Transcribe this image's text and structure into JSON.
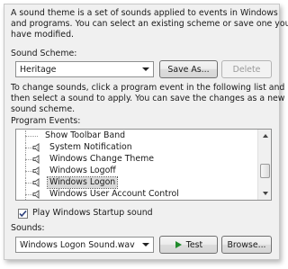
{
  "intro_text": [
    "A sound theme is a set of sounds applied to events in Windows",
    "and programs.  You can select an existing scheme or save one you",
    "have modified."
  ],
  "scheme": {
    "label": "Sound Scheme:",
    "selected": "Heritage",
    "save_as_label": "Save As...",
    "delete_label": "Delete"
  },
  "instructions": [
    "To change sounds, click a program event in the following list and",
    "then select a sound to apply.  You can save the changes as a new",
    "sound scheme."
  ],
  "program_events": {
    "label": "Program Events:",
    "items": [
      "Show Toolbar Band",
      "System Notification",
      "Windows Change Theme",
      "Windows Logoff",
      "Windows Logon",
      "Windows User Account Control"
    ],
    "selected_index": 4
  },
  "startup": {
    "label": "Play Windows Startup sound",
    "checked": true
  },
  "sounds": {
    "label": "Sounds:",
    "selected": "Windows Logon Sound.wav",
    "test_label": "Test",
    "browse_label": "Browse..."
  },
  "colors": {
    "panel_bg": "#f0f0f0",
    "selection_bg": "#dadada",
    "play_icon": "#1f8a2b"
  },
  "icons": {
    "event": "speaker-icon",
    "play": "play-icon",
    "dropdown": "chevron-down-icon",
    "check": "checkmark-icon"
  }
}
